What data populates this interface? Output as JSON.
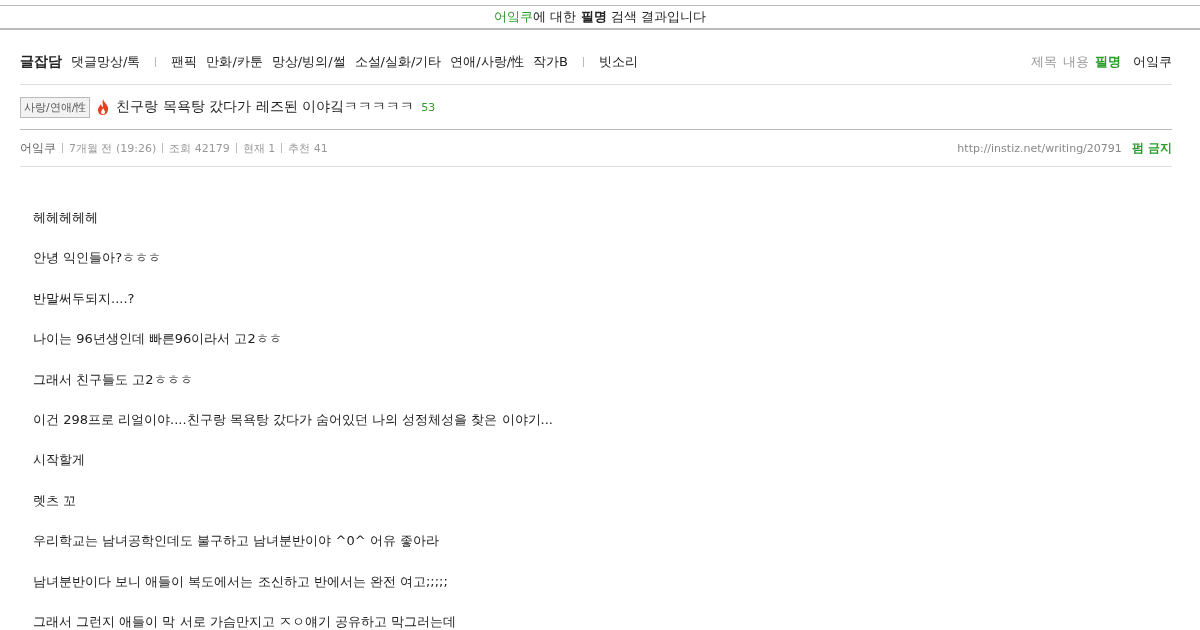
{
  "banner": {
    "term": "어잌쿠",
    "text": "에 대한 **필명** 검색 결과입니다"
  },
  "nav": {
    "home": "글잡담",
    "groups": [
      [
        "댓글망상/톡"
      ],
      [
        "팬픽",
        "만화/카툰",
        "망상/빙의/썰",
        "소설/실화/기타",
        "연애/사랑/性",
        "작가B"
      ],
      [
        "빗소리"
      ]
    ]
  },
  "search_scope": [
    {
      "label": "제목",
      "selected": false
    },
    {
      "label": "내용",
      "selected": false
    },
    {
      "label": "필명",
      "selected": true
    }
  ],
  "search_query": "어잌쿠",
  "post": {
    "tag": "사랑/연애/性",
    "hot": true,
    "title": "친구랑 목욕탕 갔다가 레즈된 이야깈ㅋㅋㅋㅋㅋ",
    "comments": "53",
    "author": "어잌쿠",
    "meta": [
      "7개월 전 (19:26)",
      "조회 42179",
      "현재 1",
      "추천 41"
    ],
    "url": "http://instiz.net/writing/20791",
    "notice": "펌 금지"
  },
  "body": [
    "헤헤헤헤헤",
    "안녕 익인들아?ㅎㅎㅎ",
    "반말써두되지....?",
    "나이는 96년생인데 빠른96이라서 고2ㅎㅎ",
    "그래서 친구들도 고2ㅎㅎㅎ",
    "이건 298프로 리얼이야....친구랑 목욕탕 갔다가 숨어있던 나의 성정체성을 찾은 이야기...",
    "시작할게",
    "렛츠 꼬",
    "우리학교는 남녀공학인데도 불구하고 남녀분반이야 ^0^ 어유 좋아라",
    "남녀분반이다 보니 애들이 복도에서는 조신하고 반에서는 완전 여고;;;;;",
    "그래서 그런지 애들이 막 서로 가슴만지고 ㅈㅇ얘기 공유하고 막그러는데"
  ]
}
